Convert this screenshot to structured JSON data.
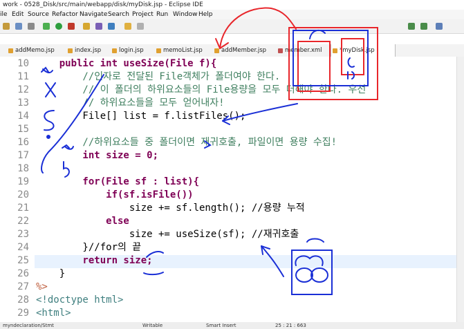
{
  "window": {
    "title": "work - 0528_Disk/src/main/webapp/disk/myDisk.jsp - Eclipse IDE"
  },
  "menu": [
    "ile",
    "Edit",
    "Source",
    "Refactor",
    "Navigate",
    "Search",
    "Project",
    "Run",
    "Window",
    "Help"
  ],
  "tabs": [
    {
      "label": "addMemo.jsp"
    },
    {
      "label": "index.jsp"
    },
    {
      "label": "login.jsp"
    },
    {
      "label": "memoList.jsp"
    },
    {
      "label": "addMember.jsp"
    },
    {
      "label": "member.xml"
    },
    {
      "label": "*myDisk.jsp",
      "active": true
    }
  ],
  "code_lines": [
    {
      "no": "10",
      "text": "    public int useSize(File f){"
    },
    {
      "no": "11",
      "text": "        //인자로 전달된 File객체가 폴더여야 한다."
    },
    {
      "no": "12",
      "text": "        // 이 폴더의 하위요소들의 File용량을 모두 더해야 한다. 우선"
    },
    {
      "no": "13",
      "text": "        // 하위요소들을 모두 얻어내자!"
    },
    {
      "no": "14",
      "text": "        File[] list = f.listFiles();"
    },
    {
      "no": "15",
      "text": ""
    },
    {
      "no": "16",
      "text": "        //하위요소들 중 폴더이면 재귀호출, 파일이면 용량 수집!"
    },
    {
      "no": "17",
      "text": "        int size = 0;"
    },
    {
      "no": "18",
      "text": ""
    },
    {
      "no": "19",
      "text": "        for(File sf : list){"
    },
    {
      "no": "20",
      "text": "            if(sf.isFile())"
    },
    {
      "no": "21",
      "text": "                size += sf.length(); //용량 누적"
    },
    {
      "no": "22",
      "text": "            else"
    },
    {
      "no": "23",
      "text": "                size += useSize(sf); //재귀호출"
    },
    {
      "no": "24",
      "text": "        }//for의 끝"
    },
    {
      "no": "25",
      "text": "        return size;"
    },
    {
      "no": "26",
      "text": "    }"
    },
    {
      "no": "27",
      "text": "%>"
    },
    {
      "no": "28",
      "text": "<!doctype html>"
    },
    {
      "no": "29",
      "text": "<html>"
    }
  ],
  "status": {
    "path": "myndeclaration/Stmt",
    "mode": "Writable",
    "insert": "Smart Insert",
    "position": "25 : 21 : 663"
  },
  "colors": {
    "keyword": "#7f0055",
    "comment": "#3f7f5f",
    "tag": "#3f7f7f",
    "current_line": "#e8f2fe",
    "annotation_red": "#e8262b",
    "annotation_blue": "#1a2fd6"
  }
}
